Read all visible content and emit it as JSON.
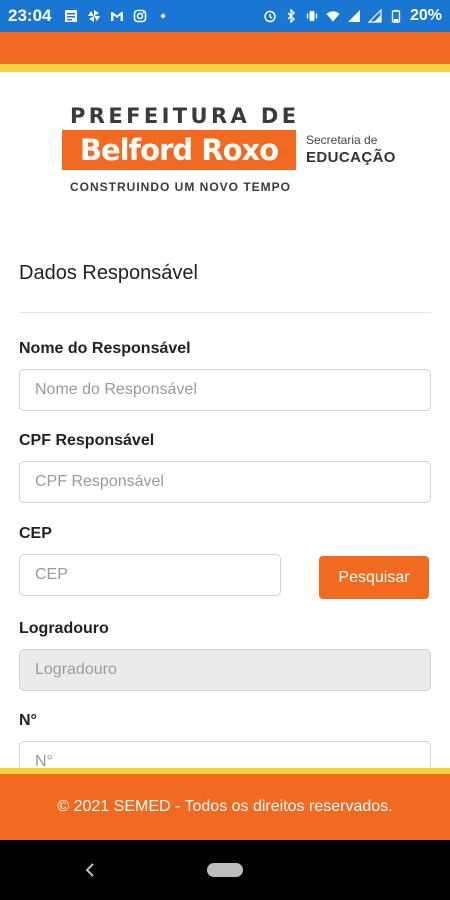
{
  "status_bar": {
    "time": "23:04",
    "battery": "20%"
  },
  "logo": {
    "top_line": "PREFEITURA DE",
    "city": "Belford Roxo",
    "department_line1": "Secretaria de",
    "department_line2": "EDUCAÇÃO",
    "tagline": "CONSTRUINDO UM NOVO TEMPO"
  },
  "form": {
    "section_title": "Dados Responsável",
    "fields": [
      {
        "label": "Nome do Responsável",
        "placeholder": "Nome do Responsável",
        "value": ""
      },
      {
        "label": "CPF Responsável",
        "placeholder": "CPF Responsável",
        "value": ""
      },
      {
        "label": "CEP",
        "placeholder": "CEP",
        "value": ""
      },
      {
        "label": "Logradouro",
        "placeholder": "Logradouro",
        "value": ""
      },
      {
        "label": "N°",
        "placeholder": "N°",
        "value": ""
      }
    ],
    "search_button": "Pesquisar"
  },
  "footer": {
    "text": "© 2021 SEMED - Todos os direitos reservados."
  },
  "colors": {
    "status_bar": "#1976d2",
    "brand_orange": "#f26a21",
    "accent_yellow": "#f7d23e",
    "disabled_input": "#ebebeb"
  }
}
